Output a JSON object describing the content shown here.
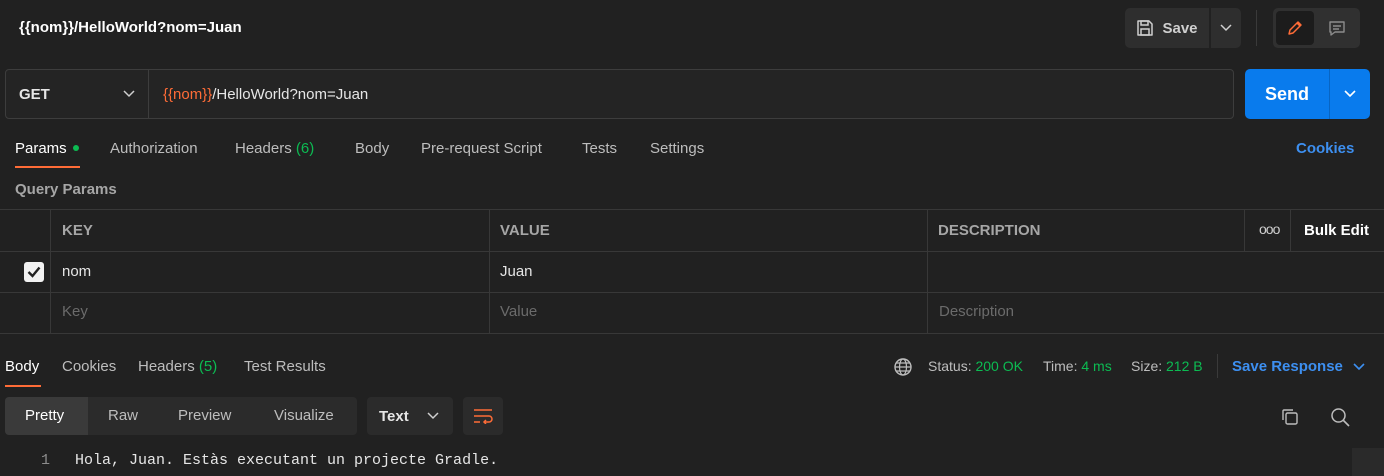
{
  "request": {
    "title": "{{nom}}/HelloWorld?nom=Juan",
    "method": "GET",
    "url_var": "{{nom}}",
    "url_rest": "/HelloWorld?nom=Juan"
  },
  "toolbar": {
    "save_label": "Save",
    "send_label": "Send"
  },
  "req_tabs": {
    "params": "Params",
    "authorization": "Authorization",
    "headers": "Headers",
    "headers_count": "(6)",
    "body": "Body",
    "prerequest": "Pre-request Script",
    "tests": "Tests",
    "settings": "Settings",
    "cookies": "Cookies"
  },
  "params": {
    "section_label": "Query Params",
    "columns": {
      "key": "KEY",
      "value": "VALUE",
      "description": "DESCRIPTION",
      "bulk_edit": "Bulk Edit",
      "more": "ooo"
    },
    "rows": [
      {
        "key": "nom",
        "value": "Juan",
        "description": "",
        "checked": true
      }
    ],
    "placeholders": {
      "key": "Key",
      "value": "Value",
      "description": "Description"
    }
  },
  "response": {
    "tabs": {
      "body": "Body",
      "cookies": "Cookies",
      "headers": "Headers",
      "headers_count": "(5)",
      "test_results": "Test Results"
    },
    "status_label": "Status:",
    "status_value": "200 OK",
    "time_label": "Time:",
    "time_value": "4 ms",
    "size_label": "Size:",
    "size_value": "212 B",
    "save_response": "Save Response",
    "formats": {
      "pretty": "Pretty",
      "raw": "Raw",
      "preview": "Preview",
      "visualize": "Visualize"
    },
    "language": "Text",
    "lines": [
      {
        "no": "1",
        "text": "Hola, Juan. Estàs executant un projecte Gradle."
      }
    ]
  },
  "colors": {
    "accent": "#ff6c37",
    "primary": "#097bed",
    "link": "#3d8ff0",
    "success": "#0cbb52"
  }
}
